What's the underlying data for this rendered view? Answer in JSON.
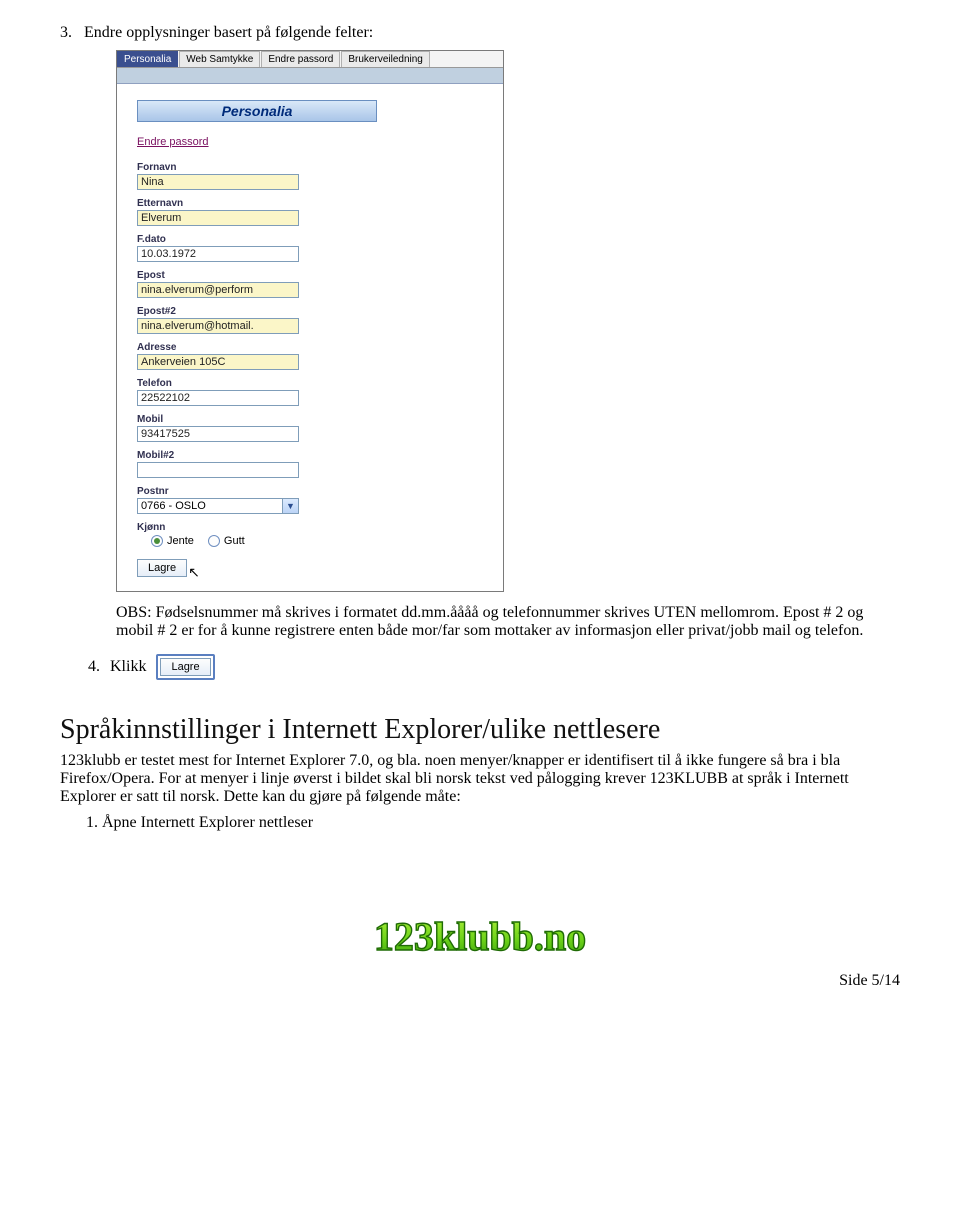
{
  "step3": {
    "num": "3.",
    "text": "Endre opplysninger basert på følgende felter:"
  },
  "embed": {
    "tabs": [
      "Personalia",
      "Web Samtykke",
      "Endre passord",
      "Brukerveiledning"
    ],
    "banner": "Personalia",
    "change_pw": "Endre passord",
    "fields": {
      "fornavn": {
        "label": "Fornavn",
        "value": "Nina"
      },
      "etternavn": {
        "label": "Etternavn",
        "value": "Elverum"
      },
      "fdato": {
        "label": "F.dato",
        "value": "10.03.1972"
      },
      "epost": {
        "label": "Epost",
        "value": "nina.elverum@perform"
      },
      "epost2": {
        "label": "Epost#2",
        "value": "nina.elverum@hotmail."
      },
      "adresse": {
        "label": "Adresse",
        "value": "Ankerveien 105C"
      },
      "telefon": {
        "label": "Telefon",
        "value": "22522102"
      },
      "mobil": {
        "label": "Mobil",
        "value": "93417525"
      },
      "mobil2": {
        "label": "Mobil#2",
        "value": ""
      },
      "postnr": {
        "label": "Postnr",
        "value": "0766 - OSLO"
      },
      "kjonn": {
        "label": "Kjønn",
        "jente": "Jente",
        "gutt": "Gutt"
      }
    },
    "save_btn": "Lagre"
  },
  "obs": "OBS: Fødselsnummer må skrives i formatet dd.mm.åååå og telefonnummer skrives UTEN mellomrom. Epost # 2 og mobil # 2 er for å kunne registrere enten både mor/far som mottaker av informasjon eller privat/jobb mail og telefon.",
  "step4": {
    "num": "4.",
    "text": "Klikk",
    "btn": "Lagre"
  },
  "heading": "Språkinnstillinger i Internett Explorer/ulike nettlesere",
  "para": "123klubb er testet mest for Internet Explorer 7.0, og bla. noen menyer/knapper er identifisert til å ikke fungere så bra i bla Firefox/Opera. For at menyer i linje øverst i bildet skal bli norsk tekst ved pålogging krever 123KLUBB at språk i Internett Explorer er satt til norsk. Dette kan du gjøre på følgende måte:",
  "list1": "Åpne Internett Explorer nettleser",
  "logo_text": "123klubb.no",
  "page": "Side 5/14"
}
